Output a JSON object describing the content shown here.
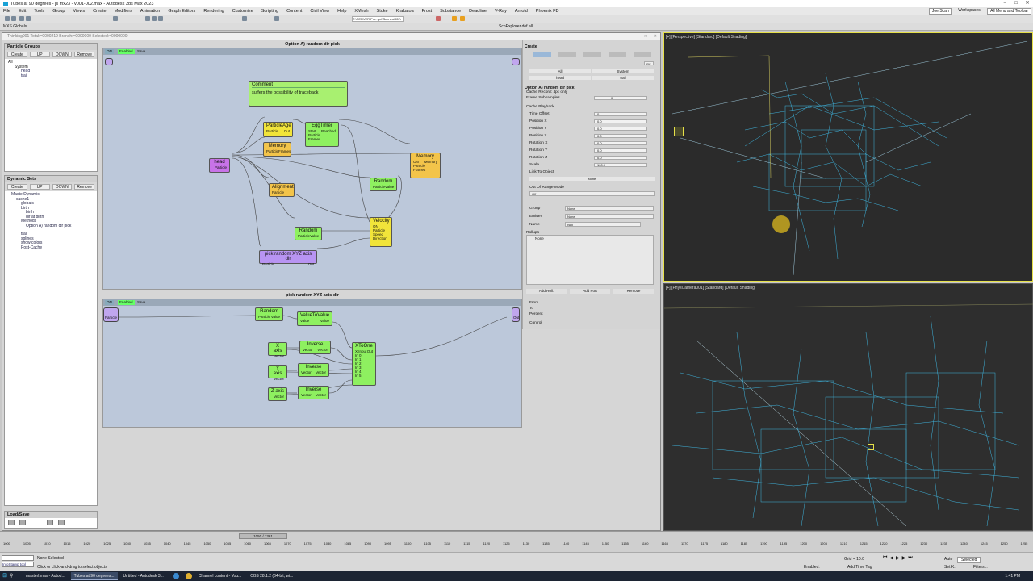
{
  "window": {
    "title": "Tubes at 90 degrees - js mx23 - v001-002.max - Autodesk 3ds Max 2023",
    "controls": [
      "−",
      "□",
      "✕"
    ]
  },
  "menu": {
    "items": [
      "File",
      "Edit",
      "Tools",
      "Group",
      "Views",
      "Create",
      "Modifiers",
      "Animation",
      "Graph Editors",
      "Rendering",
      "Customize",
      "Scripting",
      "Content",
      "Civil View",
      "Help",
      "XMesh",
      "Stoke",
      "Krakatoa",
      "Frost",
      "Substance",
      "Deadline",
      "V-Ray",
      "Arnold",
      "Phoenix FD"
    ],
    "user": "Joe Scarr",
    "workspaces_label": "Workspaces:",
    "workspace": "All Menu and Toolbar"
  },
  "toolbar": {
    "path": "Z:\\SERVER\\Pro...prt\\Scenes\\002\\",
    "explorer": "ScnExplorer  def all"
  },
  "editor": {
    "title": "Thinking001  Total:=0000219  Branch:=0000000  Selected:=0000000",
    "graph1_title": "Option A)  random dir pick",
    "graph2_title": "pick random XYZ axis dir",
    "tool_buttons": [
      "ON",
      "Enabled",
      "Save"
    ]
  },
  "particle_groups": {
    "header": "Particle Groups",
    "buttons": [
      "Create",
      "UP",
      "DOWN",
      "Remove"
    ],
    "tree": [
      "All",
      "System",
      "head",
      "trail"
    ]
  },
  "dynamic_sets": {
    "header": "Dynamic Sets",
    "buttons": [
      "Create",
      "UP",
      "DOWN",
      "Remove"
    ],
    "tree": [
      "MasterDynamic",
      "cache1",
      "globals",
      "birth",
      "birth",
      "dir at birth",
      "Methods",
      "Option A)  random dir pick",
      "trail",
      "splines",
      "show colors",
      "Post-Cache"
    ]
  },
  "load_save": {
    "header": "Load/Save"
  },
  "nodes_graph1": {
    "comment_title": "Comment",
    "comment_text": "suffers the possibility of traceback",
    "head": {
      "title": "head",
      "port": "Particle"
    },
    "particle_age": {
      "title": "ParticleAge",
      "ports": [
        "Particle",
        "Out"
      ]
    },
    "memory1": {
      "title": "Memory",
      "ports": [
        "Particle",
        "Frames"
      ]
    },
    "egg_timer": {
      "title": "EggTimer",
      "ports": [
        "Start",
        "Reached",
        "Particle",
        "Frames"
      ]
    },
    "memory2": {
      "title": "Memory",
      "ports": [
        "ON",
        "Memory",
        "Particle",
        "Frames"
      ]
    },
    "alignment": {
      "title": "Alignment",
      "ports": [
        "Particle"
      ]
    },
    "random1": {
      "title": "Random",
      "ports": [
        "Particle",
        "Value"
      ]
    },
    "random2": {
      "title": "Random",
      "ports": [
        "Particle",
        "Value"
      ]
    },
    "velocity": {
      "title": "Velocity",
      "ports": [
        "ON",
        "Particle",
        "Speed",
        "Direction"
      ]
    },
    "pick": {
      "title": "pick random XYZ axis dir",
      "ports": [
        "Particle",
        "Out"
      ]
    }
  },
  "nodes_graph2": {
    "random": {
      "title": "Random",
      "ports": [
        "Particle",
        "Value"
      ]
    },
    "value_to_value": {
      "title": "ValueToValue",
      "ports": [
        "Value",
        "Value"
      ]
    },
    "x_axis": {
      "title": "X axis",
      "port": "Vector"
    },
    "y_axis": {
      "title": "Y axis",
      "port": "Vector"
    },
    "z_axis": {
      "title": "Z axis",
      "port": "Vector"
    },
    "inverse1": {
      "title": "Inverse",
      "ports": [
        "Vector",
        "Vector"
      ]
    },
    "inverse2": {
      "title": "Inverse",
      "ports": [
        "Vector",
        "Vector"
      ]
    },
    "inverse3": {
      "title": "Inverse",
      "ports": [
        "Vector",
        "Vector"
      ]
    },
    "xtoone": {
      "title": "XToOne",
      "ports": [
        "X Input",
        "Out",
        "In 0",
        "In 1",
        "In 2",
        "In 3",
        "In 4",
        "In 5"
      ]
    },
    "input_port": "Particle",
    "output_port": "Out"
  },
  "right_panel": {
    "create_header": "Create",
    "system_buttons": [
      "All",
      "System",
      "head",
      "trail"
    ],
    "section_title": "Option A)  random dir pick",
    "cache_record": "Cache Record: .tpc only",
    "frame_subsamples": {
      "label": "Frame Subsamples",
      "value": "0"
    },
    "cache_playback": "Cache Playback",
    "fields": [
      {
        "label": "Time Offset",
        "value": "0"
      },
      {
        "label": "Position X",
        "value": "0.0"
      },
      {
        "label": "Position Y",
        "value": "0.0"
      },
      {
        "label": "Position Z",
        "value": "0.0"
      },
      {
        "label": "Rotation X",
        "value": "0.0"
      },
      {
        "label": "Rotation Y",
        "value": "0.0"
      },
      {
        "label": "Rotation Z",
        "value": "0.0"
      },
      {
        "label": "Scale",
        "value": "100.0"
      }
    ],
    "link_to_object": "Link To Object",
    "link_value": "None",
    "out_of_range": "Out Of Range Mode",
    "out_of_range_value": "Off",
    "group": {
      "label": "Group",
      "value": "None"
    },
    "emitter": {
      "label": "Emitter",
      "value": "None"
    },
    "name": {
      "label": "Name",
      "value": "Null"
    },
    "rollups": "Rollups",
    "rollup_item": "None",
    "buttons": [
      "Add Roll.",
      "Add Port",
      "Remove"
    ],
    "from_label": "From",
    "to_label": "To",
    "percent_label": "Percent",
    "control_label": "Control"
  },
  "viewports": {
    "top_label": "[+] [Perspective] [Standard] [Default Shading]",
    "bottom_label": "[+] [PhysCamera001] [Standard] [Default Shading]"
  },
  "timeline": {
    "frame": "1050 / 1361",
    "ticks": [
      "1000",
      "1005",
      "1010",
      "1015",
      "1020",
      "1025",
      "1030",
      "1035",
      "1040",
      "1045",
      "1050",
      "1055",
      "1060",
      "1065",
      "1070",
      "1075",
      "1080",
      "1085",
      "1090",
      "1095",
      "1100",
      "1105",
      "1110",
      "1115",
      "1120",
      "1125",
      "1130",
      "1135",
      "1140",
      "1145",
      "1150",
      "1155",
      "1160",
      "1165",
      "1170",
      "1175",
      "1180",
      "1185",
      "1190",
      "1195",
      "1200",
      "1205",
      "1210",
      "1215",
      "1220",
      "1225",
      "1230",
      "1235",
      "1240",
      "1245",
      "1250",
      "1255"
    ]
  },
  "status": {
    "selection": "None Selected",
    "hint": "Click or click-and-drag to select objects",
    "script_field": "InfoStamp tool",
    "grid": "Grid = 10.0",
    "add_time_tag": "Add Time Tag",
    "enabled": "Enabled:",
    "auto": "Auto",
    "selected": "Selected",
    "set_k": "Set K.",
    "filters": "Filters..."
  },
  "taskbar": {
    "items": [
      "masterl.max - Autod...",
      "Tubes at 90 degrees...",
      "Untitled - Autodesk 3...",
      "Channel content - You...",
      "OBS 28.1.2 (64-bit, wi..."
    ],
    "time": "1:41 PM"
  },
  "colors": {
    "graph_bg": "#bcc8da",
    "node_yellow": "#f1e43a",
    "node_orange": "#f3c44a",
    "node_green": "#8ef060",
    "node_purple": "#b894f2",
    "viewport_bg": "#2b2b2b",
    "wire": "#3fb6e0",
    "active_border": "#e6e04a"
  }
}
